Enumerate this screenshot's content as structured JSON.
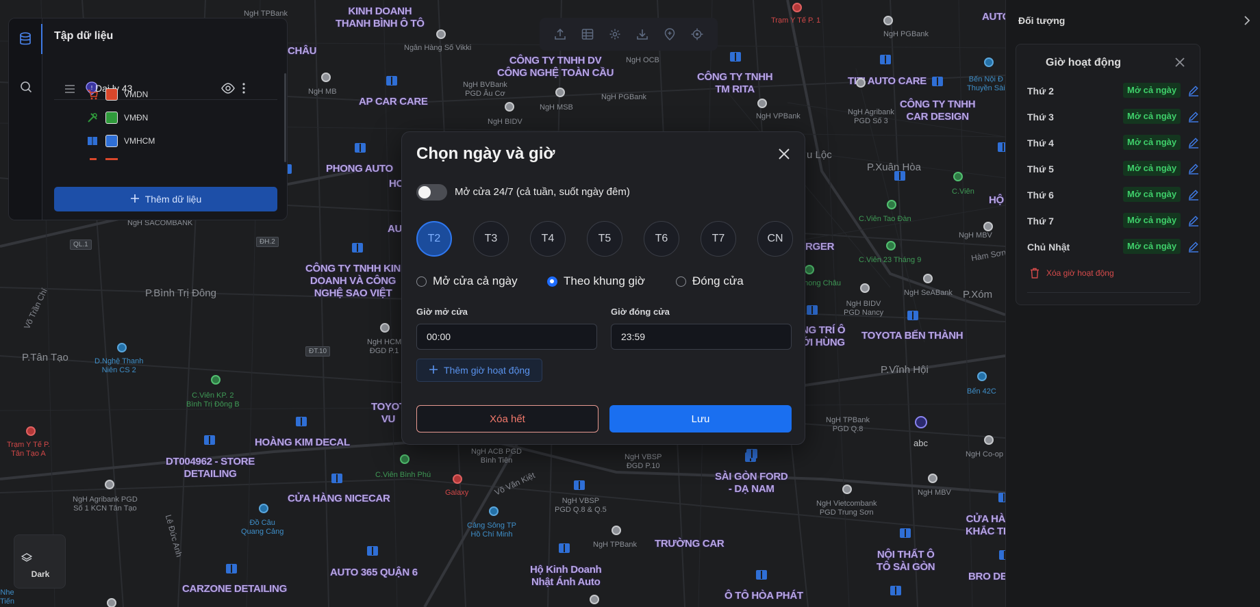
{
  "dataset_panel": {
    "title": "Tập dữ liệu",
    "layer_name": "Dai ly 43",
    "legend": [
      {
        "label": "VMDN",
        "color": "#d9472b",
        "icon": "cart-icon"
      },
      {
        "label": "VMĐN",
        "color": "#2f9a3b",
        "icon": "tools-icon"
      },
      {
        "label": "VMHCM",
        "color": "#2f6fd6",
        "icon": "book-icon"
      }
    ],
    "add_button": "Thêm dữ liệu"
  },
  "toolbar": {
    "tools": [
      "upload-icon",
      "table-icon",
      "gear-icon",
      "download-icon",
      "add-pin-icon",
      "locate-icon"
    ]
  },
  "basemap": {
    "label": "Dark"
  },
  "modal": {
    "title": "Chọn ngày và giờ",
    "toggle_label": "Mở cửa 24/7 (cả tuần, suốt ngày đêm)",
    "days": [
      "T2",
      "T3",
      "T4",
      "T5",
      "T6",
      "T7",
      "CN"
    ],
    "active_day": "T2",
    "modes": [
      "Mở cửa cả ngày",
      "Theo khung giờ",
      "Đóng cửa"
    ],
    "selected_mode": "Theo khung giờ",
    "open_label": "Giờ mở cửa",
    "open_value": "00:00",
    "close_label": "Giờ đóng cửa",
    "close_value": "23:59",
    "add_hours": "Thêm giờ hoạt động",
    "clear": "Xóa hết",
    "save": "Lưu"
  },
  "right_panel": {
    "title": "Đối tượng",
    "hours_title": "Giờ hoạt động",
    "hours": [
      {
        "day": "Thứ 2",
        "status": "Mở cả ngày"
      },
      {
        "day": "Thứ 3",
        "status": "Mở cả ngày"
      },
      {
        "day": "Thứ 4",
        "status": "Mở cả ngày"
      },
      {
        "day": "Thứ 5",
        "status": "Mở cả ngày"
      },
      {
        "day": "Thứ 6",
        "status": "Mở cả ngày"
      },
      {
        "day": "Thứ 7",
        "status": "Mở cả ngày"
      },
      {
        "day": "Chủ Nhật",
        "status": "Mở cả ngày"
      }
    ],
    "delete_label": "Xóa giờ hoạt động"
  },
  "map": {
    "labels": {
      "kinh_doanh": "KINH DOANH\nTHANH BÌNH Ô TÔ",
      "toan_cau": "CÔNG TY TNHH DV\nCÔNG NGHỆ TOÀN CẦU",
      "tm_rita": "CÔNG TY TNHH\nTM RITA",
      "titi": "TITI AUTO CARE",
      "car_design": "CÔNG TY TNHH\nCAR DESIGN",
      "ap_car": "AP CAR CARE",
      "phong_auto": "PHONG AUTO",
      "sao_viet": "CÔNG TY TNHH KIN\nDOANH VÀ CÔNG\nNGHỆ SAO VIỆT",
      "chau": "CHÂU",
      "ho": "HO",
      "au": "AU",
      "toyo": "TOYOT\nVU",
      "hoang_kim": "HOÀNG KIM DECAL",
      "dt004962": "DT004962 - STORE\nDETAILING",
      "nicecar": "CỬA HÀNG NICECAR",
      "carzone": "CARZONE DETAILING",
      "auto365": "AUTO 365 QUẬN 6",
      "nhat_anh": "Hộ Kinh Doanh\nNhật Ánh Auto",
      "truong_car": "TRƯỜNG CAR",
      "sg_ford": "SÀI GÒN FORD\n- DẠ NAM",
      "o_to_hoa_phat": "Ô TÔ HÒA PHÁT",
      "noi_that": "NỘI THẤT Ô\nTÔ SÀI GÒN",
      "toyota_bt": "TOYOTA BẾN THÀNH",
      "tri_o": "NG TRÍ Ô\nỚI HÙNG",
      "rger": "RGER",
      "auto_right": "AUTO",
      "ho_right": "HỘ",
      "cua_ha": "CỬA HÀ\nKHẮC TI",
      "bro": "BRO DE"
    },
    "small": {
      "tpbank": "NgH TPBank",
      "vikki": "Ngân Hàng Số Vikki",
      "ocb": "NgH OCB",
      "pgbank": "NgH PGBank",
      "mb": "NgH MB",
      "bvbank": "NgH BVBank\nPGD Âu Cơ",
      "msb": "NgH MSB",
      "pgbank2": "NgH PGBank",
      "agribank": "NgH Agribank\nPGD Số 3",
      "vpbank": "NgH VPBank",
      "bidv": "NgH BIDV",
      "sacombank": "NgH SACOMBANK",
      "mbv": "NgH MBV",
      "seabank": "NgH SeABank",
      "bidv_nancy": "NgH BIDV\nPGD Nancy",
      "hcm_bank": "NgH HCM\nĐGD P.1",
      "acb": "NgH ACB PGD\nBình Tiên",
      "vbsp": "NgH VBSP\nĐGD P.10",
      "vbsp2": "NgH VBSP\nPGD Q.8 & Q.5",
      "tpbank_q8": "NgH TPBank\nPGD Q.8",
      "co_op": "NgH Co-op",
      "mbv2": "NgH MBV",
      "vietcombank": "NgH Vietcombank\nPGD Trung Sơn",
      "tpbank3": "NgH TPBank",
      "agribank_tt": "NgH Agribank PGD\nSố 1 KCN Tân Tạo",
      "abc": "abc"
    },
    "areas": {
      "binh_tri_dong": "P.Bình Trị Đông",
      "tan_tao": "P.Tân Tạo",
      "xuan_hoa": "P.Xuân Hòa",
      "vinh_hoi": "P.Vĩnh Hội",
      "xom": "P.Xóm",
      "u_loc": "u Lộc"
    },
    "green": {
      "cvien": "C.Viên",
      "cvien_tao_dan": "C.Viên Tao Đàn",
      "cvien_23": "C.Viên 23 Tháng 9",
      "cvien_kp2": "C.Viên KP. 2\nBình Trị Đông B",
      "cvien_binh_phu": "C.Viên Bình Phú",
      "chong_chau": "phong Châu"
    },
    "red": {
      "tram_yte_p1": "Trạm Y Tế P. 1",
      "tram_yte_tt": "Trạm Y Tế P.\nTân Tạo A",
      "galaxy": "Galaxy"
    },
    "blue": {
      "nghe_thanh": "D.Nghệ Thanh\nNiên CS 2",
      "ben_noi": "Bến Nội Đ\nThuyền Sài",
      "ben_42c": "Bến 42C",
      "do_cau": "Đồ Câu\nQuang Cảng",
      "cang_song": "Cảng Sông TP\nHồ Chí Minh",
      "nhe_tien": "Nhe\nTiến"
    },
    "roads": {
      "vo_tran_chi": "Võ Trần Chí",
      "vo_van_kiet": "Võ Văn Kiệt",
      "ham_son": "Hàm Sơn",
      "le_duc_anh": "Lê Đức Anh"
    },
    "shields": {
      "ql1": "QL.1",
      "dh2": "ĐH.2",
      "dt10": "ĐT.10"
    }
  }
}
